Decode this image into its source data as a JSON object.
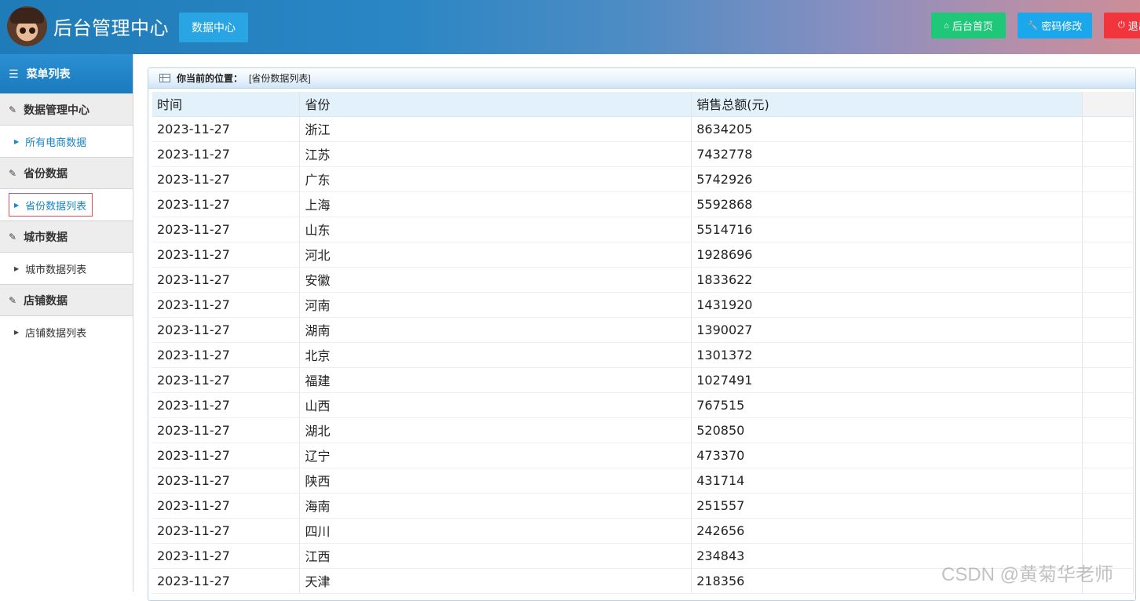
{
  "header": {
    "title": "后台管理中心",
    "data_center_label": "数据中心",
    "home_label": "后台首页",
    "password_label": "密码修改",
    "logout_label": "退出",
    "accent_green": "#1fc878",
    "accent_blue": "#1aa7ec",
    "accent_red": "#f2353d"
  },
  "sidebar": {
    "menu_title": "菜单列表",
    "groups": [
      {
        "label": "数据管理中心",
        "items": [
          {
            "label": "所有电商数据"
          }
        ]
      },
      {
        "label": "省份数据",
        "items": [
          {
            "label": "省份数据列表"
          }
        ]
      },
      {
        "label": "城市数据",
        "items": [
          {
            "label": "城市数据列表"
          }
        ]
      },
      {
        "label": "店铺数据",
        "items": [
          {
            "label": "店铺数据列表"
          }
        ]
      }
    ]
  },
  "location": {
    "label": "你当前的位置：",
    "value": "[省份数据列表]"
  },
  "table": {
    "columns": [
      "时间",
      "省份",
      "销售总额(元)"
    ],
    "rows": [
      [
        "2023-11-27",
        "浙江",
        "8634205"
      ],
      [
        "2023-11-27",
        "江苏",
        "7432778"
      ],
      [
        "2023-11-27",
        "广东",
        "5742926"
      ],
      [
        "2023-11-27",
        "上海",
        "5592868"
      ],
      [
        "2023-11-27",
        "山东",
        "5514716"
      ],
      [
        "2023-11-27",
        "河北",
        "1928696"
      ],
      [
        "2023-11-27",
        "安徽",
        "1833622"
      ],
      [
        "2023-11-27",
        "河南",
        "1431920"
      ],
      [
        "2023-11-27",
        "湖南",
        "1390027"
      ],
      [
        "2023-11-27",
        "北京",
        "1301372"
      ],
      [
        "2023-11-27",
        "福建",
        "1027491"
      ],
      [
        "2023-11-27",
        "山西",
        "767515"
      ],
      [
        "2023-11-27",
        "湖北",
        "520850"
      ],
      [
        "2023-11-27",
        "辽宁",
        "473370"
      ],
      [
        "2023-11-27",
        "陕西",
        "431714"
      ],
      [
        "2023-11-27",
        "海南",
        "251557"
      ],
      [
        "2023-11-27",
        "四川",
        "242656"
      ],
      [
        "2023-11-27",
        "江西",
        "234843"
      ],
      [
        "2023-11-27",
        "天津",
        "218356"
      ]
    ]
  },
  "watermark": "CSDN @黄菊华老师"
}
